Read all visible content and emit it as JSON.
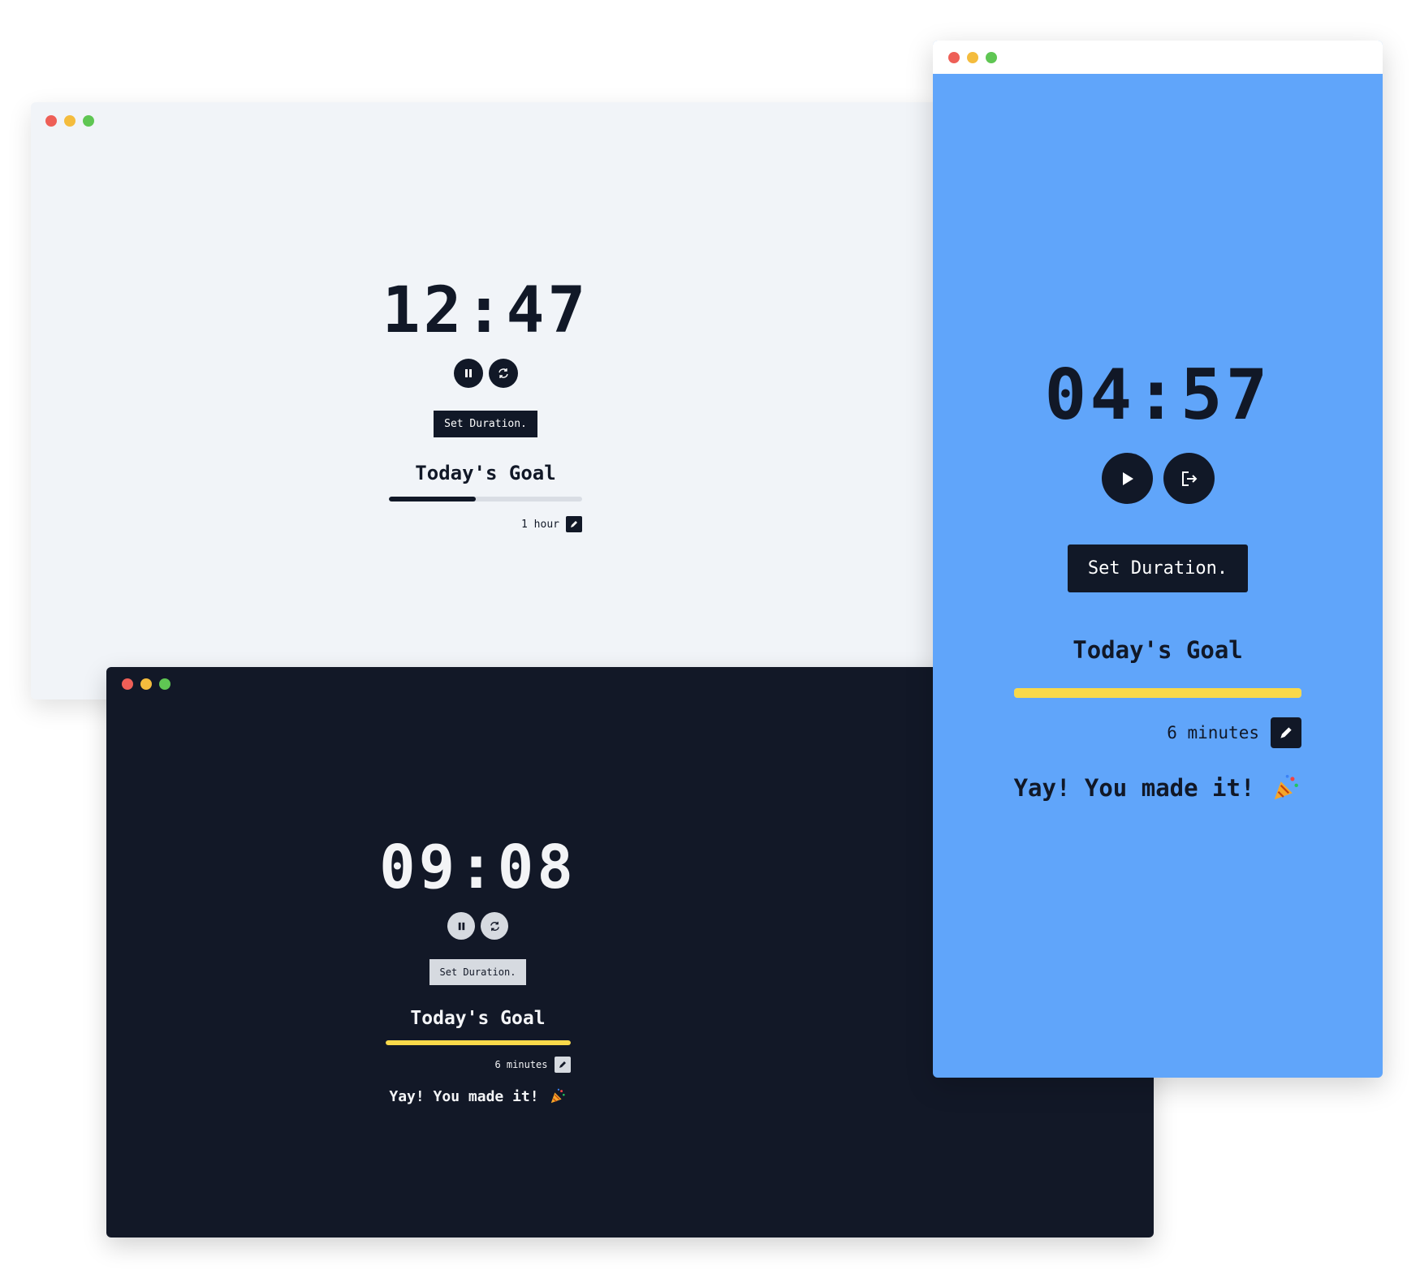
{
  "windows": {
    "light": {
      "clock": "12:47",
      "set_duration_label": "Set Duration.",
      "goal_title": "Today's Goal",
      "goal_progress": 0.45,
      "goal_amount": "1 hour",
      "controls": [
        "pause-icon",
        "refresh-icon"
      ],
      "colors": {
        "background": "#f1f4f8",
        "text": "#111827",
        "progress": "#111827"
      }
    },
    "dark": {
      "clock": "09:08",
      "set_duration_label": "Set Duration.",
      "goal_title": "Today's Goal",
      "goal_progress": 1.0,
      "goal_amount": "6 minutes",
      "message": "Yay! You made it!",
      "controls": [
        "pause-icon",
        "refresh-icon"
      ],
      "colors": {
        "background": "#121827",
        "text": "#f3f4f6",
        "progress": "#f9d94a"
      }
    },
    "blue": {
      "clock": "04:57",
      "set_duration_label": "Set Duration.",
      "goal_title": "Today's Goal",
      "goal_progress": 1.0,
      "goal_amount": "6 minutes",
      "message": "Yay! You made it!",
      "controls": [
        "play-icon",
        "exit-icon"
      ],
      "colors": {
        "background": "#60a5fa",
        "text": "#111827",
        "progress": "#f9d94a"
      }
    }
  }
}
